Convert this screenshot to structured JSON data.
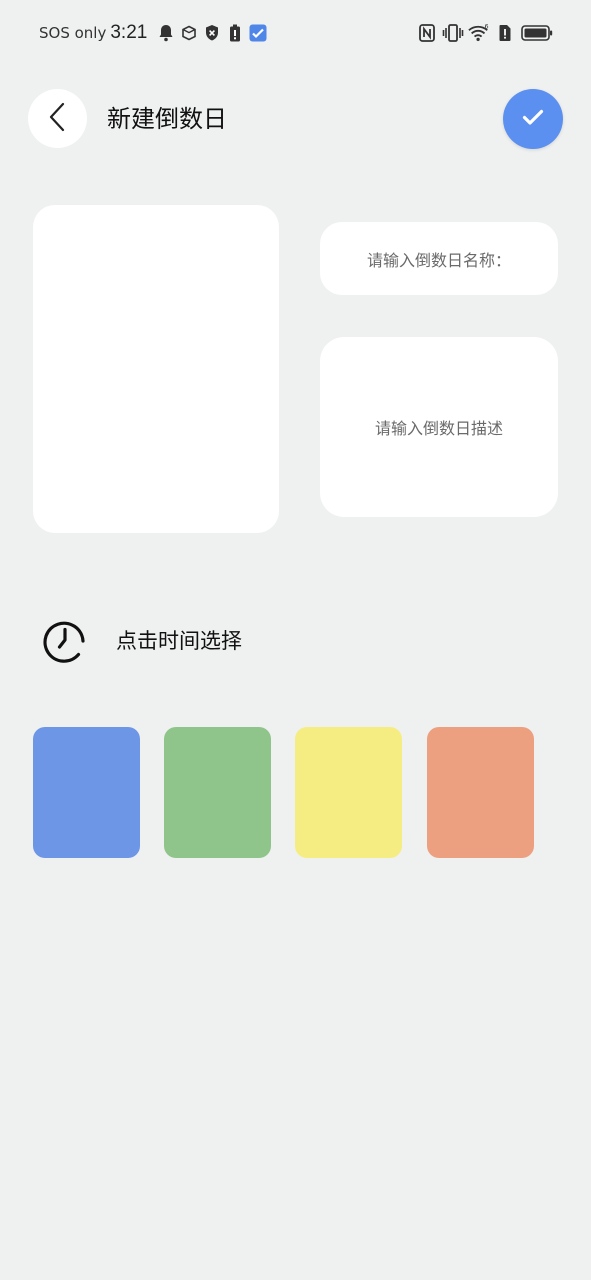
{
  "status_bar": {
    "carrier": "SOS only",
    "time": "3:21",
    "left_icons": [
      "bell-icon",
      "app-box-icon",
      "shield-x-icon",
      "battery-saver-icon",
      "app-check-icon"
    ],
    "right_icons": [
      "nfc-icon",
      "vibrate-icon",
      "wifi-icon",
      "sim-alert-icon",
      "battery-icon"
    ]
  },
  "header": {
    "title": "新建倒数日",
    "back_icon": "chevron-left-icon",
    "confirm_icon": "check-icon",
    "confirm_color": "#5b8ff0"
  },
  "form": {
    "name_placeholder": "请输入倒数日名称：",
    "description_placeholder": "请输入倒数日描述"
  },
  "time_picker": {
    "icon": "clock-icon",
    "label": "点击时间选择"
  },
  "colors": [
    {
      "name": "blue",
      "hex": "#6e96e6"
    },
    {
      "name": "green",
      "hex": "#8fc48a"
    },
    {
      "name": "yellow",
      "hex": "#f5ed82"
    },
    {
      "name": "orange",
      "hex": "#eca080"
    }
  ],
  "page_background": "#eff0f0"
}
